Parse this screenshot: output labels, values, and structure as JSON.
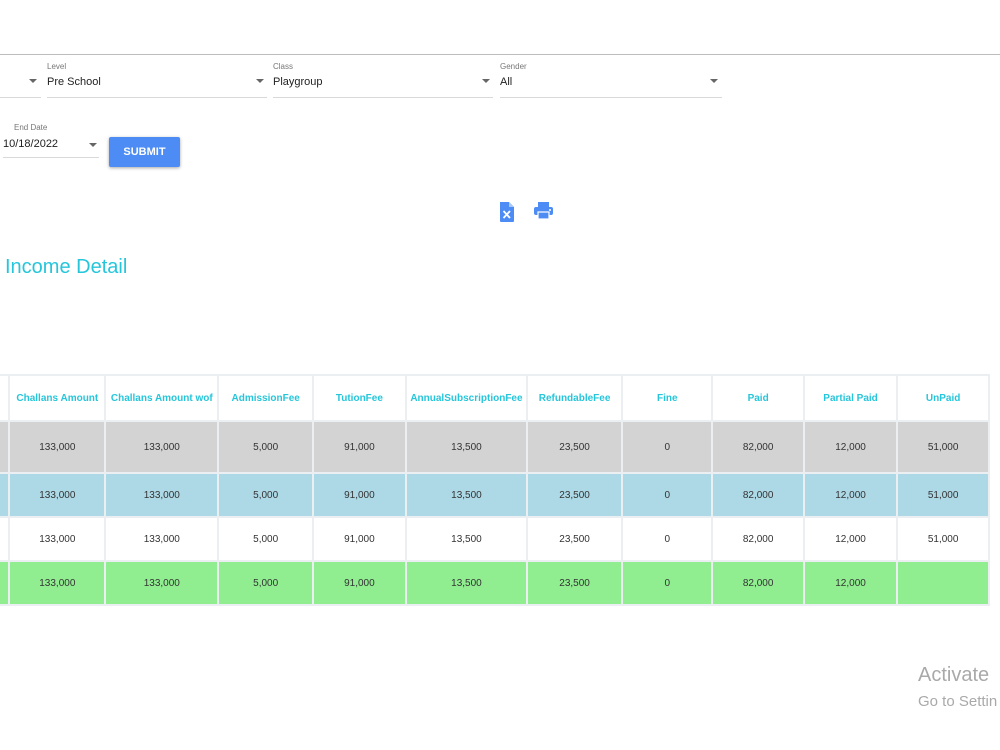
{
  "filters": {
    "level": {
      "label": "Level",
      "value": "Pre School"
    },
    "class": {
      "label": "Class",
      "value": "Playgroup"
    },
    "gender": {
      "label": "Gender",
      "value": "All"
    },
    "end_date": {
      "label": "End Date",
      "value": "10/18/2022"
    },
    "submit_label": "SUBMIT"
  },
  "toolbar": {
    "icons": [
      "excel-export-icon",
      "print-icon"
    ],
    "accent": "#4d8cf5"
  },
  "section_title": "Income Detail",
  "table": {
    "headers": [
      "",
      "Challans Amount",
      "Challans Amount wof",
      "AdmissionFee",
      "TutionFee",
      "AnnualSubscriptionFee",
      "RefundableFee",
      "Fine",
      "Paid",
      "Partial Paid",
      "UnPaid"
    ],
    "rows": [
      [
        "",
        "133,000",
        "133,000",
        "5,000",
        "91,000",
        "13,500",
        "23,500",
        "0",
        "82,000",
        "12,000",
        "51,000"
      ],
      [
        "",
        "133,000",
        "133,000",
        "5,000",
        "91,000",
        "13,500",
        "23,500",
        "0",
        "82,000",
        "12,000",
        "51,000"
      ],
      [
        "",
        "133,000",
        "133,000",
        "5,000",
        "91,000",
        "13,500",
        "23,500",
        "0",
        "82,000",
        "12,000",
        "51,000"
      ],
      [
        "",
        "133,000",
        "133,000",
        "5,000",
        "91,000",
        "13,500",
        "23,500",
        "0",
        "82,000",
        "12,000",
        ""
      ]
    ],
    "row_colors": [
      "#d3d3d3",
      "#add8e6",
      "#ffffff",
      "#90ee90"
    ],
    "header_color": "#26c6da"
  },
  "watermark": {
    "line1": "Activate",
    "line2": "Go to Settin"
  }
}
